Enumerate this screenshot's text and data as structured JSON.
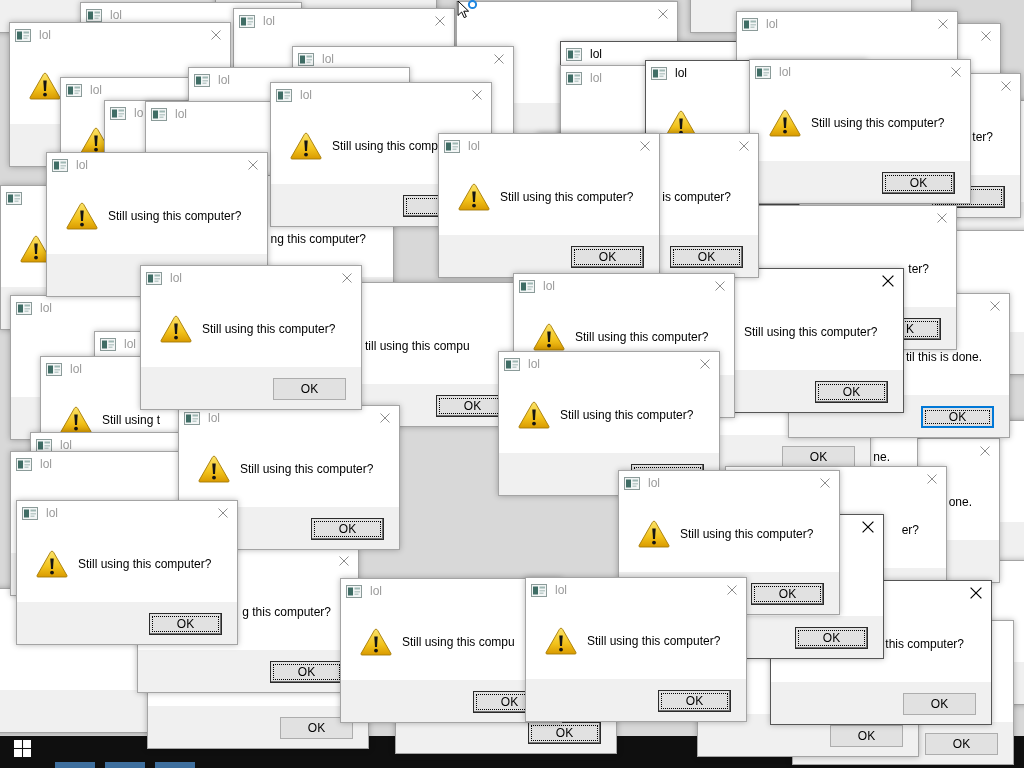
{
  "desktop": {
    "windows": [
      {
        "active": false
      },
      {
        "active": false,
        "title": "lol"
      },
      {
        "active": false
      },
      {
        "active": false,
        "title": "lol"
      },
      {
        "active": false,
        "title": "lol"
      },
      {
        "active": false,
        "title": "lol"
      },
      {
        "active": false,
        "title": "lo"
      },
      {
        "active": false,
        "title": "lol"
      },
      {
        "active": false,
        "title": "lol"
      },
      {
        "active": false,
        "title": "lol"
      },
      {
        "active": false
      },
      {
        "active": false,
        "title": "lol",
        "message": "Still using this computer?"
      },
      {
        "active": false,
        "title": "lol",
        "message": "Still using this comp",
        "button": {
          "focused": true,
          "highlighted": false
        }
      },
      {
        "active": false
      },
      {
        "active": false
      },
      {
        "active": true,
        "title": "lol"
      },
      {
        "active": false,
        "title": "lol"
      },
      {
        "active": false,
        "title": "lol"
      },
      {
        "active": true,
        "title": "lol"
      },
      {
        "active": false
      },
      {
        "active": false,
        "message": "ng this computer?"
      },
      {
        "active": false,
        "title": "lol"
      },
      {
        "active": false,
        "title": "lol"
      },
      {
        "active": false,
        "title": "lol",
        "message": "Still using this computer?",
        "button": {
          "label": "OK",
          "focused": false,
          "highlighted": false
        }
      },
      {
        "active": false,
        "title": "lol",
        "message": "Still using this computer?",
        "button": {
          "label": "OK",
          "focused": true,
          "highlighted": false
        }
      },
      {
        "active": false,
        "title": "lol",
        "message": "Still using this computer?",
        "button": {
          "label": "OK",
          "focused": true,
          "highlighted": false
        }
      },
      {
        "active": false,
        "message": "is computer?",
        "button": {
          "label": "OK",
          "focused": true,
          "highlighted": false
        }
      },
      {
        "active": false,
        "title": "lol",
        "message": "Still using t"
      },
      {
        "active": false,
        "message": "till using this compu",
        "button": {
          "label": "OK",
          "focused": true,
          "highlighted": false
        }
      },
      {
        "active": false,
        "title": "lol",
        "message": "Still using this computer?"
      },
      {
        "active": false,
        "message": "ter?",
        "button": {
          "label": "K",
          "focused": true,
          "highlighted": false
        }
      },
      {
        "active": false,
        "message": "ter?",
        "button": {
          "focused": true,
          "highlighted": false
        }
      },
      {
        "active": false
      },
      {
        "active": false,
        "title": "lol"
      },
      {
        "active": false,
        "title": "lol"
      },
      {
        "active": false,
        "title": "lol",
        "message": "Still using this computer?",
        "button": {
          "label": "OK",
          "focused": true,
          "highlighted": false
        }
      },
      {
        "active": false,
        "title": "lol",
        "message": "Still using this computer?",
        "button": {
          "focused": true,
          "highlighted": false
        }
      },
      {
        "active": true,
        "message": "Still using this computer?",
        "button": {
          "label": "OK",
          "focused": true,
          "highlighted": false
        }
      },
      {
        "active": false
      },
      {
        "active": false,
        "button": {
          "label": "OK",
          "focused": false,
          "highlighted": false
        }
      },
      {
        "active": false,
        "message": "til this is done.",
        "button": {
          "label": "OK",
          "focused": true,
          "highlighted": true
        }
      },
      {
        "message": "ne."
      },
      {
        "active": false,
        "title": "lol",
        "message": "Still using this computer?",
        "button": {
          "label": "OK",
          "focused": true,
          "highlighted": false
        }
      },
      {
        "active": false,
        "message": "g this computer?",
        "button": {
          "label": "OK",
          "focused": true,
          "highlighted": false
        }
      },
      {
        "active": false
      },
      {
        "active": false,
        "title": "lol",
        "message": "Still using this compu",
        "button": {
          "label": "OK",
          "focused": true,
          "highlighted": false
        }
      },
      {
        "active": false,
        "title": "lol",
        "message": "Still using this computer?",
        "button": {
          "label": "OK",
          "focused": true,
          "highlighted": false
        }
      },
      {
        "active": false,
        "button": {
          "label": "OK",
          "focused": false,
          "highlighted": false
        }
      },
      {
        "active": false,
        "title": "lol",
        "message": "Still using this computer?",
        "button": {
          "label": "OK",
          "focused": true,
          "highlighted": false
        }
      },
      {
        "active": true,
        "button": {
          "label": "OK",
          "focused": true,
          "highlighted": false
        }
      },
      {
        "active": false,
        "message": "er?"
      },
      {
        "active": false,
        "message": "one."
      },
      {
        "active": false,
        "button": {
          "label": "OK",
          "focused": true,
          "highlighted": false
        }
      },
      {
        "active": false,
        "button": {
          "label": "OK",
          "focused": false,
          "highlighted": false
        }
      },
      {
        "active": true,
        "message": "this computer?",
        "button": {
          "label": "OK",
          "focused": false,
          "highlighted": false
        }
      },
      {
        "active": false
      },
      {
        "active": false
      },
      {
        "active": false,
        "button": {
          "label": "OK",
          "focused": false,
          "highlighted": false
        }
      }
    ]
  }
}
